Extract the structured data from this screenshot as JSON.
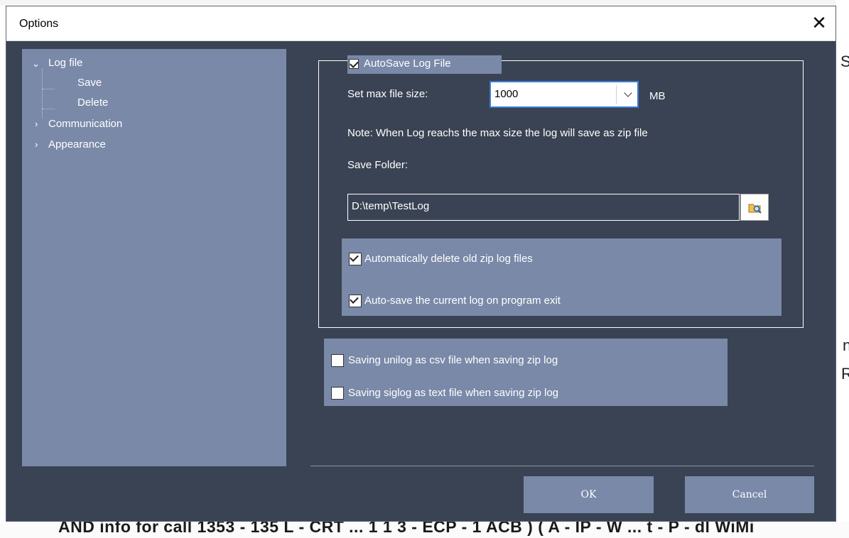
{
  "dialog": {
    "title": "Options",
    "close_label": "✕"
  },
  "tree": {
    "items": [
      {
        "label": "Log file",
        "expanded": true
      },
      {
        "label": "Save"
      },
      {
        "label": "Delete"
      },
      {
        "label": "Communication",
        "expanded": false
      },
      {
        "label": "Appearance",
        "expanded": false
      }
    ]
  },
  "autosave": {
    "label": "AutoSave Log File",
    "checked": true,
    "max_size_label": "Set max file size:",
    "max_size_value": "1000",
    "max_size_unit": "MB",
    "note": "Note: When Log reachs the max size the log will save as zip file",
    "folder_label": "Save Folder:",
    "folder_value": "D:\\temp\\TestLog",
    "options": [
      {
        "label": "Automatically delete old zip log files",
        "checked": true
      },
      {
        "label": "Auto-save the current log on program exit",
        "checked": true
      }
    ]
  },
  "extra_options": [
    {
      "label": "Saving unilog as csv file when saving zip log",
      "checked": false
    },
    {
      "label": "Saving siglog as text file when saving zip log",
      "checked": false
    }
  ],
  "buttons": {
    "ok": "OK",
    "cancel": "Cancel"
  },
  "background": {
    "right_fragments": [
      "S",
      "n",
      "R"
    ],
    "bottom_text": "AND info for call 1353 - 135 L - CRT ... 1 1 3 - ECP - 1 ACB ) ( A - IP - W ... t - P - dl WiMi"
  },
  "colors": {
    "dialog_bg": "#3a4353",
    "panel_bg": "#7a89a8",
    "focus_border": "#3c7bd6"
  }
}
